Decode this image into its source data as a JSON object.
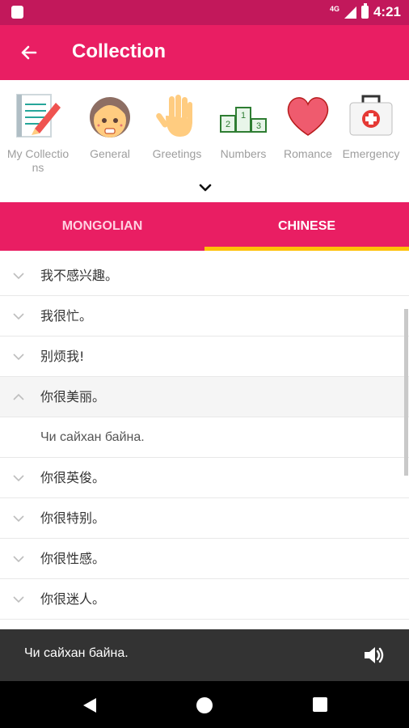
{
  "status": {
    "network": "4G",
    "time": "4:21"
  },
  "appbar": {
    "title": "Collection"
  },
  "categories": [
    {
      "label": "My Collections"
    },
    {
      "label": "General"
    },
    {
      "label": "Greetings"
    },
    {
      "label": "Numbers"
    },
    {
      "label": "Romance"
    },
    {
      "label": "Emergency"
    }
  ],
  "tabs": {
    "mongolian": "MONGOLIAN",
    "chinese": "CHINESE",
    "active": "CHINESE"
  },
  "phrases": [
    {
      "text": "我不感兴趣。",
      "expanded": false
    },
    {
      "text": "我很忙。",
      "expanded": false
    },
    {
      "text": "别烦我!",
      "expanded": false
    },
    {
      "text": "你很美丽。",
      "expanded": true,
      "translation": "Чи сайхан байна."
    },
    {
      "text": "你很英俊。",
      "expanded": false
    },
    {
      "text": "你很特别。",
      "expanded": false
    },
    {
      "text": "你很性感。",
      "expanded": false
    },
    {
      "text": "你很迷人。",
      "expanded": false
    }
  ],
  "player": {
    "text": "Чи сайхан байна."
  },
  "icons": {
    "back": "arrow-left-icon",
    "expand": "chevron-down-icon",
    "speaker": "volume-icon"
  },
  "colors": {
    "primary": "#e91e63",
    "primary_dark": "#c2185b",
    "accent": "#ffc107"
  }
}
